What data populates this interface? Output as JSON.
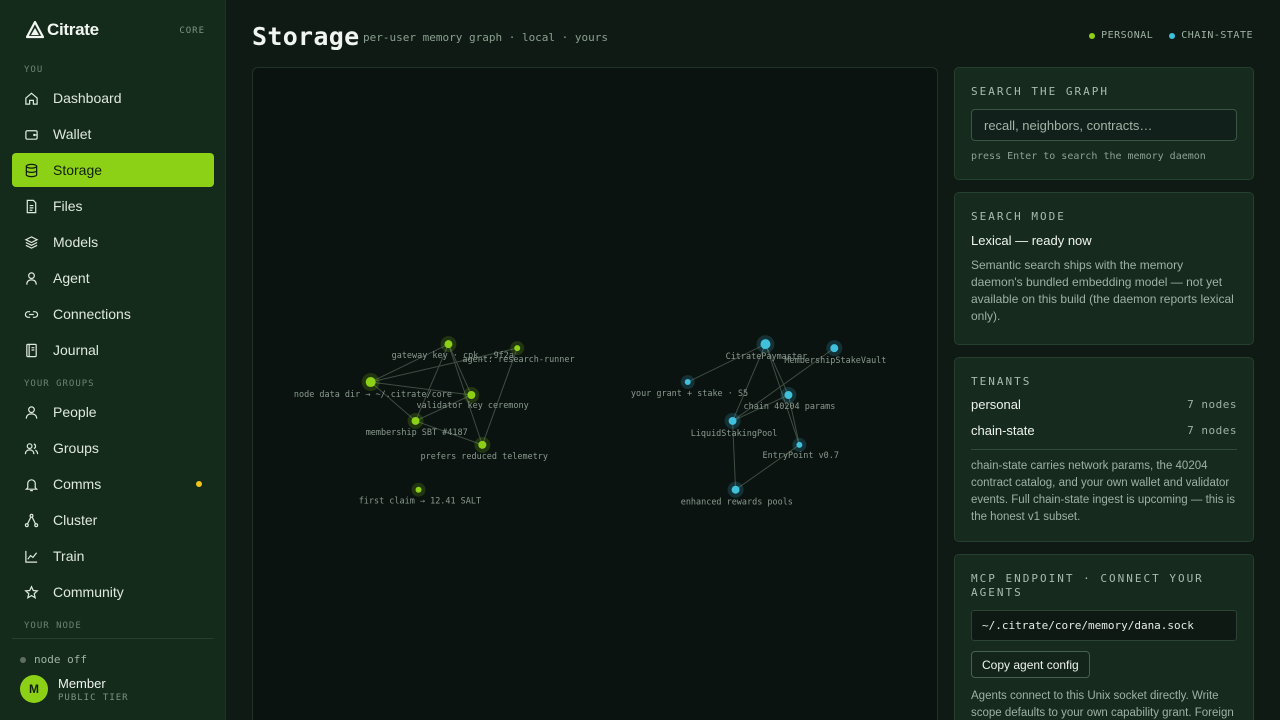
{
  "brand": {
    "name": "Citrate",
    "tag": "CORE"
  },
  "sidebar": {
    "section_you": "YOU",
    "section_groups": "YOUR GROUPS",
    "section_node": "YOUR NODE",
    "items": [
      {
        "label": "Dashboard",
        "icon": "home-icon"
      },
      {
        "label": "Wallet",
        "icon": "wallet-icon"
      },
      {
        "label": "Storage",
        "icon": "database-icon",
        "active": true
      },
      {
        "label": "Files",
        "icon": "file-icon"
      },
      {
        "label": "Models",
        "icon": "layers-icon"
      },
      {
        "label": "Agent",
        "icon": "agent-icon"
      },
      {
        "label": "Connections",
        "icon": "link-icon"
      },
      {
        "label": "Journal",
        "icon": "journal-icon"
      },
      {
        "label": "People",
        "icon": "person-icon"
      },
      {
        "label": "Groups",
        "icon": "group-icon"
      },
      {
        "label": "Comms",
        "icon": "bell-icon",
        "notification": true
      },
      {
        "label": "Cluster",
        "icon": "cluster-icon"
      },
      {
        "label": "Train",
        "icon": "chart-icon"
      },
      {
        "label": "Community",
        "icon": "star-icon"
      }
    ],
    "node_status": "node off",
    "user": {
      "initial": "M",
      "name": "Member",
      "tier": "PUBLIC TIER"
    }
  },
  "header": {
    "title": "Storage",
    "subtitle": "per-user memory graph · local · yours",
    "legend": [
      {
        "label": "PERSONAL",
        "color": "#8dd117"
      },
      {
        "label": "CHAIN-STATE",
        "color": "#3fc0dc"
      }
    ]
  },
  "graph": {
    "personal_nodes": [
      "gateway key · cpk_..9f2a",
      "agent: research-runner",
      "node data dir → ~/.citrate/core",
      "validator key ceremony",
      "membership SBT #4187",
      "prefers reduced telemetry",
      "first claim → 12.41 SALT"
    ],
    "chain_nodes": [
      "CitratePaymaster",
      "MembershipStakeVault",
      "your grant + stake · S5",
      "chain 40204 params",
      "LiquidStakingPool",
      "EntryPoint v0.7",
      "enhanced rewards pools"
    ]
  },
  "search": {
    "title": "SEARCH THE GRAPH",
    "placeholder": "recall, neighbors, contracts…",
    "hint": "press Enter to search the memory daemon"
  },
  "mode": {
    "title": "SEARCH MODE",
    "value": "Lexical — ready now",
    "description": "Semantic search ships with the memory daemon's bundled embedding model — not yet available on this build (the daemon reports lexical only)."
  },
  "tenants": {
    "title": "TENANTS",
    "rows": [
      {
        "name": "personal",
        "count": "7 nodes"
      },
      {
        "name": "chain-state",
        "count": "7 nodes"
      }
    ],
    "note": "chain-state carries network params, the 40204 contract catalog, and your own wallet and validator events. Full chain-state ingest is upcoming — this is the honest v1 subset."
  },
  "mcp": {
    "title": "MCP ENDPOINT · CONNECT YOUR AGENTS",
    "path": "~/.citrate/core/memory/dana.sock",
    "button": "Copy agent config",
    "note": "Agents connect to this Unix socket directly. Write scope defaults to your own capability grant. Foreign"
  }
}
